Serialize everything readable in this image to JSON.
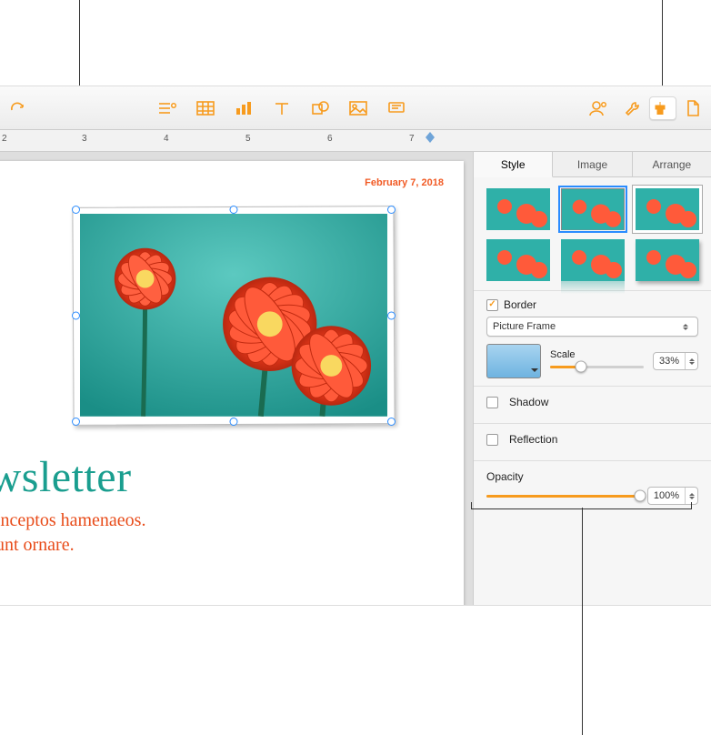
{
  "toolbar": {
    "icons": [
      "redo",
      "insert",
      "table",
      "chart",
      "text",
      "shape",
      "media",
      "comment",
      "collab",
      "tools",
      "format",
      "document"
    ]
  },
  "ruler": {
    "numbers": [
      "2",
      "3",
      "4",
      "5",
      "6",
      "7"
    ]
  },
  "document": {
    "date": "February 7, 2018",
    "headline": "Daily Newsletter",
    "body_line1": "t taciti sociosqu ad per inceptos hamenaeos.",
    "body_line2": "s urna porta non, tincidunt ornare."
  },
  "sidebar": {
    "tabs": {
      "style": "Style",
      "image": "Image",
      "arrange": "Arrange"
    },
    "border": {
      "label": "Border",
      "checked": true,
      "type": "Picture Frame",
      "scale_label": "Scale",
      "scale_value": "33%",
      "scale_pct": 33
    },
    "shadow": {
      "label": "Shadow",
      "checked": false
    },
    "reflection": {
      "label": "Reflection",
      "checked": false
    },
    "opacity": {
      "label": "Opacity",
      "value": "100%",
      "pct": 100
    }
  }
}
